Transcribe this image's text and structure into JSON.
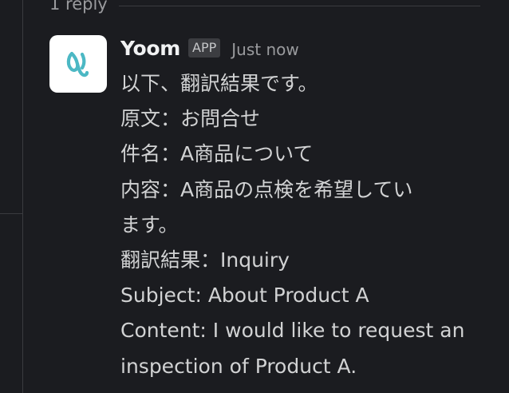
{
  "thread": {
    "reply_count": "1 reply"
  },
  "message": {
    "sender": "Yoom",
    "badge": "APP",
    "timestamp": "Just now",
    "avatar_icon": "yoom-logo-icon",
    "lines": [
      "以下、翻訳結果です。",
      "原文：お問合せ",
      "件名：A商品について",
      "内容：A商品の点検を希望してい",
      "ます。",
      "翻訳結果：Inquiry",
      "Subject: About Product A",
      "Content: I would like to request an",
      "inspection of Product A."
    ]
  },
  "colors": {
    "background": "#1b1c20",
    "text": "#d1d2d3",
    "muted": "#9a9b9e",
    "logo_teal": "#4cb8c4"
  }
}
